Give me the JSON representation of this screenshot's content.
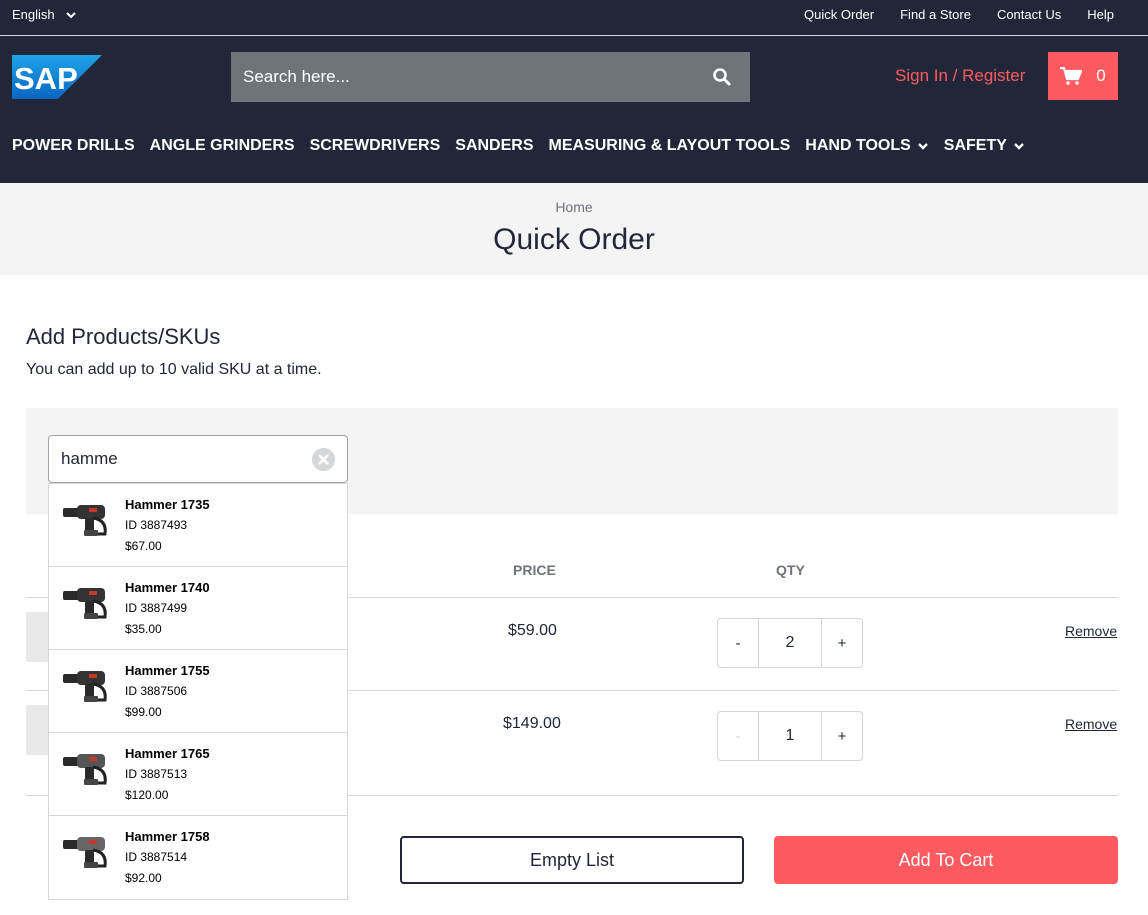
{
  "topbar": {
    "language": "English",
    "links": [
      "Quick Order",
      "Find a Store",
      "Contact Us",
      "Help"
    ]
  },
  "header": {
    "logo_text": "SAP",
    "search_placeholder": "Search here...",
    "signin_label": "Sign In / Register",
    "cart_count": "0",
    "nav": [
      {
        "label": "POWER DRILLS",
        "has_menu": false
      },
      {
        "label": "ANGLE GRINDERS",
        "has_menu": false
      },
      {
        "label": "SCREWDRIVERS",
        "has_menu": false
      },
      {
        "label": "SANDERS",
        "has_menu": false
      },
      {
        "label": "MEASURING & LAYOUT TOOLS",
        "has_menu": false
      },
      {
        "label": "HAND TOOLS",
        "has_menu": true
      },
      {
        "label": "SAFETY",
        "has_menu": true
      }
    ]
  },
  "breadcrumb": {
    "home": "Home"
  },
  "page_title": "Quick Order",
  "add_section": {
    "title": "Add Products/SKUs",
    "subtitle": "You can add up to 10 valid SKU at a time.",
    "input_value": "hamme"
  },
  "table": {
    "columns": {
      "price": "PRICE",
      "qty": "QTY"
    },
    "rows": [
      {
        "price": "$59.00",
        "qty": "2",
        "minus": "-",
        "plus": "+",
        "remove": "Remove",
        "minus_disabled": false
      },
      {
        "price": "$149.00",
        "qty": "1",
        "minus": "-",
        "plus": "+",
        "remove": "Remove",
        "minus_disabled": true
      }
    ]
  },
  "actions": {
    "empty_label": "Empty List",
    "add_label": "Add To Cart"
  },
  "suggestions": [
    {
      "name": "Hammer 1735",
      "id": "ID 3887493",
      "price": "$67.00"
    },
    {
      "name": "Hammer 1740",
      "id": "ID 3887499",
      "price": "$35.00"
    },
    {
      "name": "Hammer 1755",
      "id": "ID 3887506",
      "price": "$99.00"
    },
    {
      "name": "Hammer 1765",
      "id": "ID 3887513",
      "price": "$120.00"
    },
    {
      "name": "Hammer 1758",
      "id": "ID 3887514",
      "price": "$92.00"
    }
  ],
  "colors": {
    "navy": "#212738",
    "accent": "#ff5a5f",
    "search_bg": "#6f737a",
    "band_bg": "#f4f4f4"
  },
  "icons": [
    "chevron-down-icon",
    "search-icon",
    "cart-icon",
    "clear-icon",
    "hammer-drill-icon"
  ]
}
